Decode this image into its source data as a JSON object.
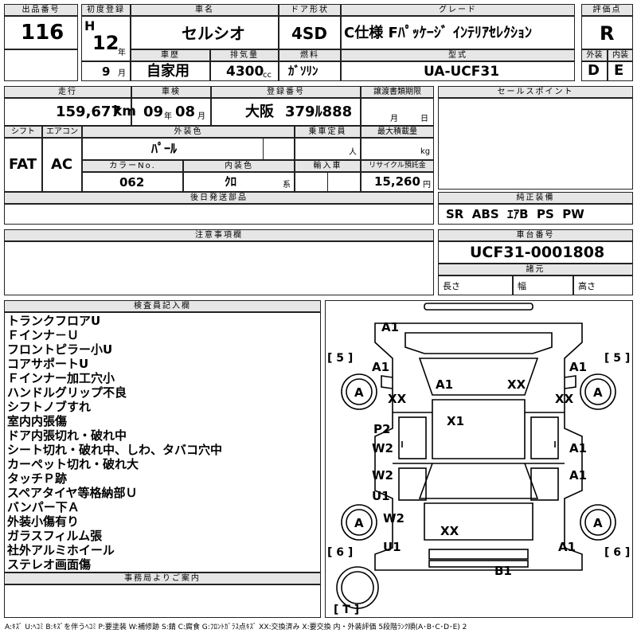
{
  "labels": {
    "lot_no": "出品番号",
    "first_reg": "初度登録",
    "car_name": "車名",
    "door": "ドア形状",
    "grade": "グレード",
    "score": "評価点",
    "history": "車歴",
    "displacement": "排気量",
    "fuel": "燃料",
    "model_code": "型式",
    "exterior": "外装",
    "interior": "内装",
    "mileage": "走行",
    "inspection": "車検",
    "reg_no": "登録番号",
    "transfer_date": "譲渡書類期限",
    "sales_point": "セールスポイント",
    "shift": "シフト",
    "aircon": "エアコン",
    "ext_color": "外装色",
    "capacity": "乗車定員",
    "max_load": "最大積載量",
    "color_no": "カラーNo.",
    "int_color": "内装色",
    "import": "輸入車",
    "recycle": "リサイクル預託金",
    "later_parts": "後日発送部品",
    "genuine": "純正装備",
    "caution": "注意事項欄",
    "chassis_no": "車台番号",
    "specs": "諸元",
    "length": "長さ",
    "width": "幅",
    "height": "高さ",
    "inspector": "検査員記入欄",
    "office": "事務局よりご案内"
  },
  "units": {
    "year": "年",
    "month": "月",
    "cc": "cc",
    "km": "km",
    "month2": "月",
    "day": "日",
    "person": "人",
    "kg": "kg",
    "kei": "系",
    "yen": "円"
  },
  "values": {
    "lot_no": "116",
    "era": "H",
    "year": "12",
    "month": "9",
    "car_name": "セルシオ",
    "door": "4SD",
    "grade": "C仕様 Fﾊﾟｯｹｰｼﾞ ｲﾝﾃﾘｱｾﾚｸｼｮﾝ",
    "score": "R",
    "history": "自家用",
    "displacement": "4300",
    "fuel": "ｶﾞｿﾘﾝ",
    "model_code": "UA-UCF31",
    "exterior_grade": "D",
    "interior_grade": "E",
    "mileage": "159,677",
    "insp_year": "09",
    "insp_month": "08",
    "reg_region": "大阪",
    "reg_number": "379ﾙ888",
    "shift": "FAT",
    "aircon": "AC",
    "ext_color": "ﾊﾟｰﾙ",
    "color_no": "062",
    "int_color": "ｸﾛ",
    "recycle": "15,260",
    "genuine": "SR  ABS  ｴｱB  PS  PW",
    "chassis_no": "UCF31-0001808"
  },
  "notes": [
    "トランクフロアU",
    "Ｆインナ－Ｕ",
    "フロントピラー小U",
    "コアサポートU",
    "Ｆインナー加工穴小",
    "ハンドルグリップ不良",
    "シフトノブすれ",
    "室内内張傷",
    "ドア内張切れ・破れ中",
    "シート切れ・破れ中、しわ、タバコ穴中",
    "カーペット切れ・破れ大",
    "タッチＰ跡",
    "スペアタイヤ等格納部Ｕ",
    "バンパー下Ａ",
    "外装小傷有り",
    "ガラスフィルム張",
    "社外アルミホイール",
    "ステレオ画面傷"
  ],
  "diagram": {
    "marks": [
      "A1",
      "A1",
      "A1",
      "A1",
      "XX",
      "XX",
      "XX",
      "X1",
      "P2",
      "W2",
      "W2",
      "U1",
      "W2",
      "U1",
      "A1",
      "A1",
      "A1",
      "XX",
      "B1",
      "A",
      "A",
      "A",
      "A"
    ],
    "brackets": [
      "[ 5 ]",
      "[ 5 ]",
      "[ 6 ]",
      "[ 6 ]",
      "[ T ]"
    ]
  },
  "legend": "A:ｷｽﾞ U:ﾍｺﾐ B:ｷｽﾞを伴うﾍｺﾐ P:要塗装 W:補修跡 S:錆 C:腐食 G:ﾌﾛﾝﾄｶﾞﾗｽ点ｷｽﾞ XX:交換済み X:要交換 内・外装評価 5段階ﾗﾝｸ順(A･B･C･D･E) 2"
}
